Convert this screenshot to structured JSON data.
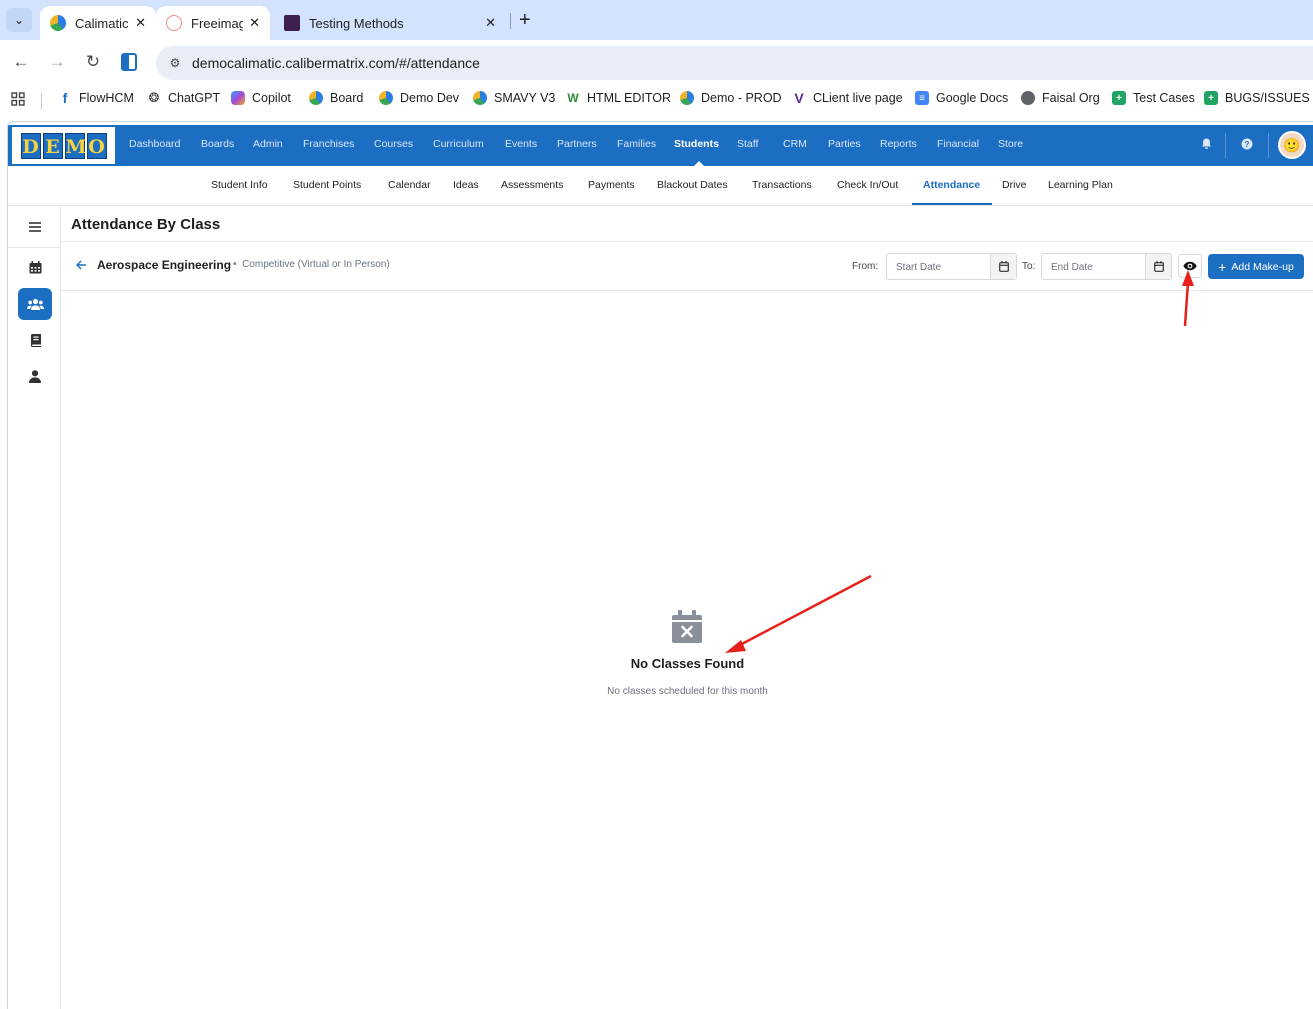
{
  "browser": {
    "tabs": [
      {
        "title": "Calimatic",
        "active": true
      },
      {
        "title": "Freeimag",
        "active": false
      },
      {
        "title": "Testing Methods",
        "active": false
      }
    ],
    "url": "democalimatic.calibermatrix.com/#/attendance",
    "bookmarks": [
      "FlowHCM",
      "ChatGPT",
      "Copilot",
      "Board",
      "Demo Dev",
      "SMAVY V3",
      "HTML EDITOR",
      "Demo - PROD",
      "CLient live page",
      "Google Docs",
      "Faisal Org",
      "Test Cases",
      "BUGS/ISSUES"
    ]
  },
  "app": {
    "logo_letters": [
      "D",
      "E",
      "M",
      "O"
    ],
    "main_nav": [
      "Dashboard",
      "Boards",
      "Admin",
      "Franchises",
      "Courses",
      "Curriculum",
      "Events",
      "Partners",
      "Families",
      "Students",
      "Staff",
      "CRM",
      "Parties",
      "Reports",
      "Financial",
      "Store"
    ],
    "main_nav_active": "Students",
    "sub_nav": [
      "Student Info",
      "Student Points",
      "Calendar",
      "Ideas",
      "Assessments",
      "Payments",
      "Blackout Dates",
      "Transactions",
      "Check In/Out",
      "Attendance",
      "Drive",
      "Learning Plan"
    ],
    "sub_nav_active": "Attendance",
    "sidebar_icons": [
      "menu-icon",
      "calendar-icon",
      "users-icon",
      "book-icon",
      "user-icon"
    ],
    "accent": "#1b6ec2"
  },
  "page": {
    "title": "Attendance By Class",
    "class_name": "Aerospace Engineering",
    "class_separator": "•",
    "class_type": "Competitive (Virtual or In Person)",
    "from_label": "From:",
    "start_placeholder": "Start Date",
    "to_label": "To:",
    "end_placeholder": "End Date",
    "add_button": "Add Make-up",
    "empty_title": "No Classes Found",
    "empty_subtitle": "No classes scheduled for this month"
  }
}
